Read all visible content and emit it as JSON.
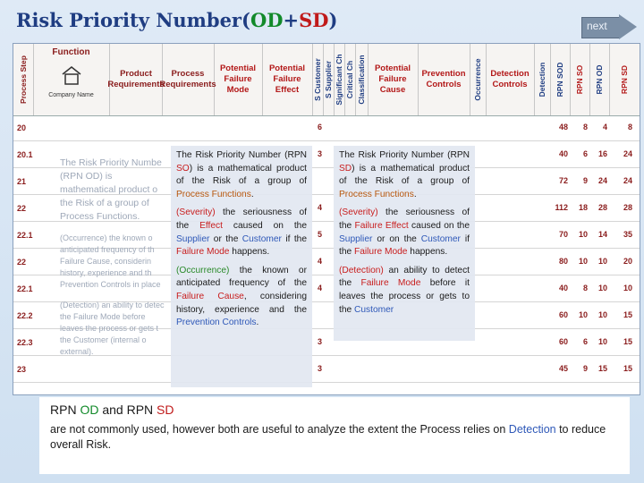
{
  "title": {
    "main": "Risk Priority Number",
    "open": "(",
    "o": "OD",
    "plus": "+",
    "s": "SD",
    "close": ")"
  },
  "nav": {
    "next_label": "next"
  },
  "header": {
    "process_step": "Process Step",
    "function": "Function",
    "product_req": "Product Requirements",
    "process_req": "Process Requirements",
    "failure_mode": "Potential Failure Mode",
    "failure_effect": "Potential Failure Effect",
    "s_customer": "S Customer",
    "s_supplier": "S Supplier",
    "significant": "Significant Ch",
    "critical": "Critical Ch",
    "classification": "Classification",
    "failure_cause": "Potential Failure Cause",
    "prevention": "Prevention Controls",
    "occurrence": "Occurrence",
    "detection_controls": "Detection Controls",
    "detection": "Detection",
    "rpn_sod": "RPN SOD",
    "rpn_so": "RPN SO",
    "rpn_od": "RPN OD",
    "rpn_sd": "RPN SD",
    "company_name": "Company Name"
  },
  "rows": [
    {
      "id": "20",
      "sev": "6",
      "rpn": [
        "48",
        "8",
        "4",
        "8"
      ]
    },
    {
      "id": "20.1",
      "sev": "3",
      "rpn": [
        "40",
        "6",
        "16",
        "24"
      ]
    },
    {
      "id": "21",
      "sev": "",
      "rpn": [
        "72",
        "9",
        "24",
        "24"
      ]
    },
    {
      "id": "22",
      "sev": "4",
      "rpn": [
        "112",
        "18",
        "28",
        "28"
      ]
    },
    {
      "id": "22.1",
      "sev": "5",
      "rpn": [
        "70",
        "10",
        "14",
        "35"
      ]
    },
    {
      "id": "22",
      "sev": "4",
      "rpn": [
        "80",
        "10",
        "10",
        "20"
      ]
    },
    {
      "id": "22.1",
      "sev": "4",
      "rpn": [
        "40",
        "8",
        "10",
        "10"
      ]
    },
    {
      "id": "22.2",
      "sev": "",
      "rpn": [
        "60",
        "10",
        "10",
        "15"
      ]
    },
    {
      "id": "22.3",
      "sev": "3",
      "rpn": [
        "60",
        "6",
        "10",
        "15"
      ]
    },
    {
      "id": "23",
      "sev": "3",
      "rpn": [
        "45",
        "9",
        "15",
        "15"
      ]
    }
  ],
  "panel_left": {
    "p1_a": "The Risk Priority Number (RPN ",
    "p1_so": "SO",
    "p1_b": ") is a mathematical product of the Risk of a group of ",
    "p1_pf": "Process Functions",
    "p1_c": ".",
    "p2_sev": "(Severity)",
    "p2_a": " the seriousness of the ",
    "p2_eff": "Effect",
    "p2_b": " caused on the ",
    "p2_sup": "Supplier",
    "p2_c": " or the ",
    "p2_cus": "Customer",
    "p2_d": " if the ",
    "p2_fm": "Failure Mode",
    "p2_e": " happens.",
    "p3_occ": "(Occurrence)",
    "p3_a": " the known or anticipated frequency of the ",
    "p3_fc": "Failure Cause",
    "p3_b": ", considering history, experience and the ",
    "p3_pc": "Prevention Controls",
    "p3_c": "."
  },
  "panel_right": {
    "p1_a": "The Risk Priority Number (RPN ",
    "p1_sd": "SD",
    "p1_b": ") is a mathematical product of the Risk of a group of ",
    "p1_pf": "Process Functions",
    "p1_c": ".",
    "p2_sev": "(Severity)",
    "p2_a": " the seriousness of the ",
    "p2_fe": "Failure Effect",
    "p2_b": " caused on the ",
    "p2_sup": "Supplier",
    "p2_c": " or on the ",
    "p2_cus": "Customer",
    "p2_d": " if the ",
    "p2_fm": "Failure Mode",
    "p2_e": " happens.",
    "p3_det": "(Detection)",
    "p3_a": " an ability to detect the ",
    "p3_fm": "Failure Mode",
    "p3_b": " before it leaves the process or gets to the ",
    "p3_cus": "Customer"
  },
  "ghost_left": {
    "l1": "The Risk Priority Numbe",
    "l2": "(RPN OD) is",
    "l3": "mathematical product o",
    "l4": "the Risk of a group of",
    "l5": "Process Functions.",
    "l6": "(Occurrence) the known o",
    "l7": "anticipated frequency of th",
    "l8": "Failure Cause, considerin",
    "l9": "history, experience and th",
    "l10": "Prevention Controls in place",
    "l11": "(Detection) an ability to detec",
    "l12": "the Failure Mode before",
    "l13": "leaves the process or gets t",
    "l14": "the Customer (internal o",
    "l15": "external)."
  },
  "bottom": {
    "h_a": "RPN ",
    "h_od": "OD",
    "h_b": "  and  RPN ",
    "h_sd": "SD",
    "t_a": "are not commonly used, however both are useful to analyze the extent the Process relies on ",
    "t_det": "Detection",
    "t_b": " to reduce overall Risk."
  }
}
